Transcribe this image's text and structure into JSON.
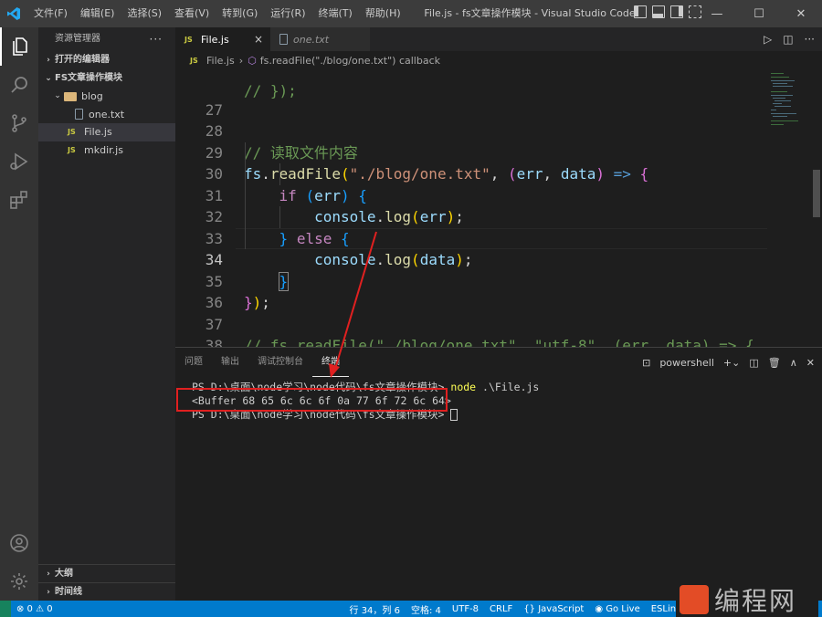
{
  "titlebar": {
    "menu": [
      "文件(F)",
      "编辑(E)",
      "选择(S)",
      "查看(V)",
      "转到(G)",
      "运行(R)",
      "终端(T)",
      "帮助(H)"
    ],
    "title": "File.js - fs文章操作模块 - Visual Studio Code",
    "minimize": "—",
    "maximize": "☐",
    "close": "✕"
  },
  "sidebar": {
    "header": "资源管理器",
    "more": "···",
    "open_editors": "打开的编辑器",
    "workspace": "FS文章操作模块",
    "tree": [
      {
        "label": "blog",
        "type": "folder"
      },
      {
        "label": "one.txt",
        "type": "file"
      },
      {
        "label": "File.js",
        "type": "js"
      },
      {
        "label": "mkdir.js",
        "type": "js"
      }
    ],
    "js_badge": "JS",
    "outline": "大纲",
    "timeline": "时间线"
  },
  "tabs": [
    {
      "label": "File.js",
      "badge": "JS",
      "close": "×"
    },
    {
      "label": "one.txt"
    }
  ],
  "breadcrumb": {
    "file": "File.js",
    "sep": "›",
    "symbol": "fs.readFile(\"./blog/one.txt\") callback"
  },
  "code": {
    "line_numbers": [
      "27",
      "28",
      "29",
      "30",
      "31",
      "32",
      "33",
      "34",
      "35",
      "36",
      "37",
      "38"
    ],
    "current_line": "34"
  },
  "panel": {
    "tabs": [
      "问题",
      "输出",
      "调试控制台",
      "终端"
    ],
    "shell": "powershell",
    "terminal": {
      "line1_prompt": "PS D:\\桌面\\node学习\\node代码\\fs文章操作模块> ",
      "line1_cmd": "node",
      "line1_arg": " .\\File.js",
      "line2": "<Buffer 68 65 6c 6c 6f 0a 77 6f 72 6c 64>",
      "line3_prompt": "PS D:\\桌面\\node学习\\node代码\\fs文章操作模块> "
    }
  },
  "statusbar": {
    "errors": "⊗ 0 ⚠ 0",
    "position": "行 34，列 6",
    "spaces": "空格: 4",
    "encoding": "UTF-8",
    "eol": "CRLF",
    "language": "{} JavaScript",
    "golive": "Go Live",
    "eslint": "ESLint"
  },
  "watermark": {
    "text": "编程网"
  },
  "colors": {
    "accent": "#007acc",
    "annotation_red": "#e02020"
  }
}
